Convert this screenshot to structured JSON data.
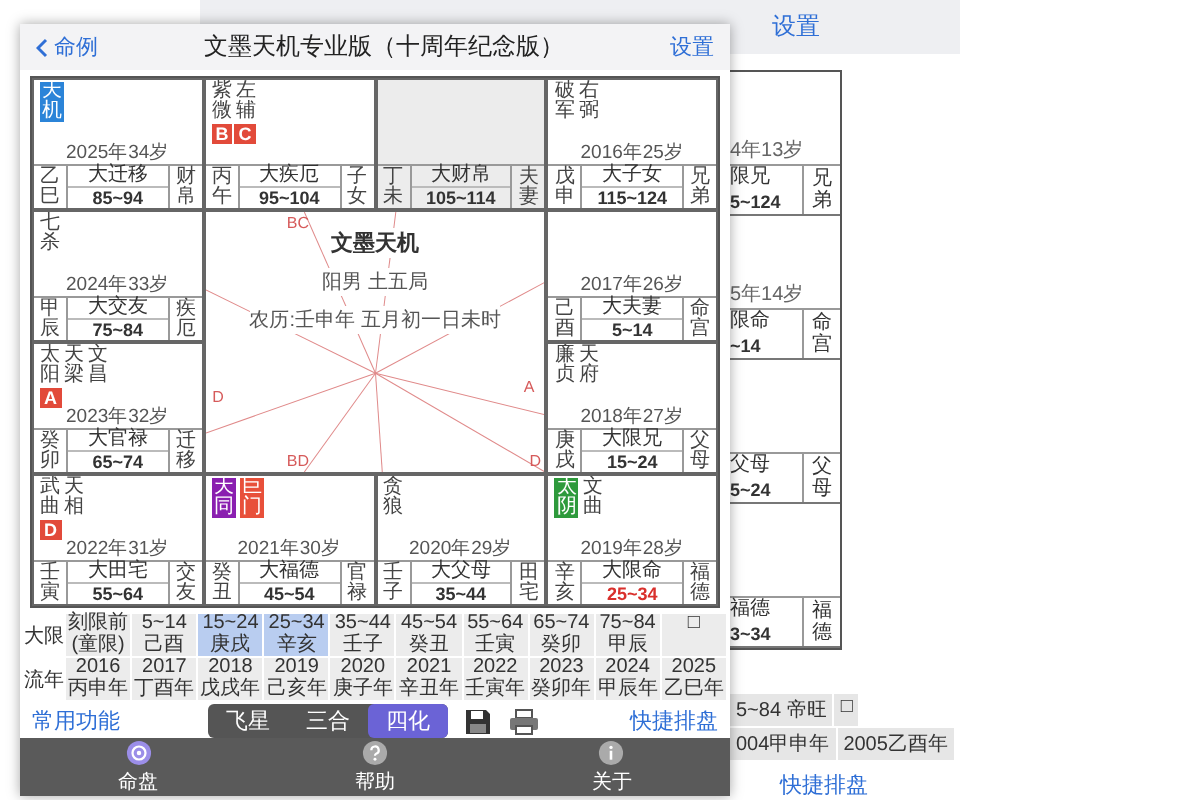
{
  "back_window": {
    "settings": "设置",
    "cells": [
      {
        "age": "4年13岁",
        "decade": "限兄",
        "range": "5~124",
        "palace": "兄弟"
      },
      {
        "age": "5年14岁",
        "decade": "限命",
        "range": "~14",
        "palace": "命宫"
      },
      {
        "decade": "父母",
        "range": "5~24",
        "palace": "父母"
      },
      {
        "decade": "福德",
        "range": "3~34",
        "palace": "福德"
      }
    ],
    "decade_cells": [
      "5~84 帝旺",
      "□"
    ],
    "year_cells": [
      "004甲申年",
      "2005乙酉年"
    ],
    "quick_button": "快捷排盘"
  },
  "window": {
    "back": "命例",
    "title": "文墨天机专业版（十周年纪念版）",
    "settings": "设置"
  },
  "chart": {
    "palaces": [
      {
        "stars": [
          {
            "name": "天机",
            "color": "#2b84d8"
          }
        ],
        "age": "2025年34岁",
        "stem_branch": "乙巳",
        "decade": "大迁移",
        "range": "85~94",
        "palace": "财帛",
        "selected": false,
        "current": false
      },
      {
        "stars": [
          {
            "name": "紫微"
          },
          {
            "name": "左辅"
          }
        ],
        "badges": [
          "B",
          "C"
        ],
        "stem_branch": "丙午",
        "decade": "大疾厄",
        "range": "95~104",
        "palace": "子女",
        "selected": false,
        "current": false
      },
      {
        "stem_branch": "丁未",
        "decade": "大财帛",
        "range": "105~114",
        "palace": "夫妻",
        "selected": true,
        "current": false
      },
      {
        "stars": [
          {
            "name": "破军"
          },
          {
            "name": "右弼"
          }
        ],
        "age": "2016年25岁",
        "stem_branch": "戊申",
        "decade": "大子女",
        "range": "115~124",
        "palace": "兄弟",
        "selected": false,
        "current": false
      },
      {
        "stars": [
          {
            "name": "七杀"
          }
        ],
        "age": "2024年33岁",
        "stem_branch": "甲辰",
        "decade": "大交友",
        "range": "75~84",
        "palace": "疾厄",
        "selected": false,
        "current": false
      },
      {
        "age": "2017年26岁",
        "stem_branch": "己酉",
        "decade": "大夫妻",
        "range": "5~14",
        "palace": "命宫",
        "selected": false,
        "current": false
      },
      {
        "stars": [
          {
            "name": "太阳"
          },
          {
            "name": "天梁"
          },
          {
            "name": "文昌"
          }
        ],
        "badges": [
          "A"
        ],
        "age": "2023年32岁",
        "stem_branch": "癸卯",
        "decade": "大官禄",
        "range": "65~74",
        "palace": "迁移",
        "selected": false,
        "current": false
      },
      {
        "stars": [
          {
            "name": "廉贞"
          },
          {
            "name": "天府"
          }
        ],
        "age": "2018年27岁",
        "stem_branch": "庚戌",
        "decade": "大限兄",
        "range": "15~24",
        "palace": "父母",
        "selected": false,
        "current": false
      },
      {
        "stars": [
          {
            "name": "武曲"
          },
          {
            "name": "天相"
          }
        ],
        "badges": [
          "D"
        ],
        "age": "2022年31岁",
        "stem_branch": "壬寅",
        "decade": "大田宅",
        "range": "55~64",
        "palace": "交友",
        "selected": false,
        "current": false
      },
      {
        "stars": [
          {
            "name": "天同",
            "color": "#8a1fb0"
          },
          {
            "name": "巨门",
            "color": "#e8503a"
          }
        ],
        "age": "2021年30岁",
        "stem_branch": "癸丑",
        "decade": "大福德",
        "range": "45~54",
        "palace": "官禄",
        "selected": false,
        "current": false
      },
      {
        "stars": [
          {
            "name": "贪狼"
          }
        ],
        "age": "2020年29岁",
        "stem_branch": "壬子",
        "decade": "大父母",
        "range": "35~44",
        "palace": "田宅",
        "selected": false,
        "current": false
      },
      {
        "stars": [
          {
            "name": "太阴",
            "color": "#2e9a3c"
          },
          {
            "name": "文曲"
          }
        ],
        "age": "2019年28岁",
        "stem_branch": "辛亥",
        "decade": "大限命",
        "range": "25~34",
        "palace": "福德",
        "selected": false,
        "current": true
      }
    ],
    "center": {
      "title": "文墨天机",
      "lines": [
        "阳男 土五局",
        "农历:壬申年 五月初一日未时"
      ],
      "line_marks": [
        "BC",
        "D",
        "A",
        "BD",
        "D"
      ]
    }
  },
  "decade_row": {
    "label": "大限",
    "cells": [
      {
        "text": "刻限前(童限)",
        "selected": false
      },
      {
        "text": "5~14 己酉",
        "selected": false
      },
      {
        "text": "15~24 庚戌",
        "selected": true
      },
      {
        "text": "25~34 辛亥",
        "selected": true
      },
      {
        "text": "35~44 壬子",
        "selected": false
      },
      {
        "text": "45~54 癸丑",
        "selected": false
      },
      {
        "text": "55~64 壬寅",
        "selected": false
      },
      {
        "text": "65~74 癸卯",
        "selected": false
      },
      {
        "text": "75~84 甲辰",
        "selected": false
      },
      {
        "text": "□",
        "selected": false
      }
    ]
  },
  "year_row": {
    "label": "流年",
    "cells": [
      "2016丙申年",
      "2017丁酉年",
      "2018戊戌年",
      "2019己亥年",
      "2020庚子年",
      "2021辛丑年",
      "2022壬寅年",
      "2023癸卯年",
      "2024甲辰年",
      "2025乙巳年"
    ]
  },
  "toolbar": {
    "left": "常用功能",
    "segments": [
      {
        "label": "飞星",
        "selected": false
      },
      {
        "label": "三合",
        "selected": false
      },
      {
        "label": "四化",
        "selected": true
      }
    ],
    "right": "快捷排盘"
  },
  "tabbar": [
    {
      "label": "命盘",
      "kind": "chart",
      "selected": true
    },
    {
      "label": "帮助",
      "kind": "help",
      "selected": false
    },
    {
      "label": "关于",
      "kind": "info",
      "selected": false
    }
  ]
}
